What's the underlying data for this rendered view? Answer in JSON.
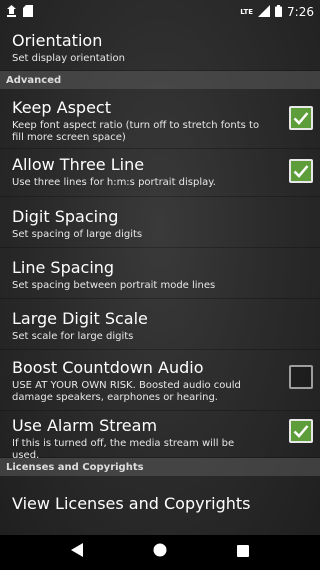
{
  "status_bar": {
    "time": "7:26",
    "network_label": "LTE",
    "left_icons": [
      "notification-icon",
      "sd-card-icon"
    ],
    "right_icons": [
      "signal-icon",
      "battery-icon"
    ]
  },
  "orientation": {
    "title": "Orientation",
    "summary": "Set display orientation"
  },
  "sections": {
    "advanced": "Advanced",
    "licenses": "Licenses and Copyrights"
  },
  "prefs": {
    "keep_aspect": {
      "title": "Keep Aspect",
      "summary": "Keep font aspect ratio (turn off to stretch fonts to fill more screen space)",
      "checked": true
    },
    "allow_three_line": {
      "title": "Allow Three Line",
      "summary": "Use three lines for h:m:s portrait display.",
      "checked": true
    },
    "digit_spacing": {
      "title": "Digit Spacing",
      "summary": "Set spacing of large digits"
    },
    "line_spacing": {
      "title": "Line Spacing",
      "summary": "Set spacing between portrait mode lines"
    },
    "large_digit_scale": {
      "title": "Large Digit Scale",
      "summary": "Set scale for large digits"
    },
    "boost_audio": {
      "title": "Boost Countdown Audio",
      "summary": "USE AT YOUR OWN RISK. Boosted audio could damage speakers, earphones or hearing.",
      "checked": false
    },
    "alarm_stream": {
      "title": "Use Alarm Stream",
      "summary": "If this is turned off, the media stream will be used.",
      "checked": true
    },
    "licenses": {
      "title": "View Licenses and Copyrights"
    }
  },
  "colors": {
    "check_on": "#5e9e3a",
    "background": "#2c2c2c",
    "navbar": "#000000"
  },
  "nav_bar": {
    "icons": [
      "back-icon",
      "home-icon",
      "recents-icon"
    ]
  }
}
